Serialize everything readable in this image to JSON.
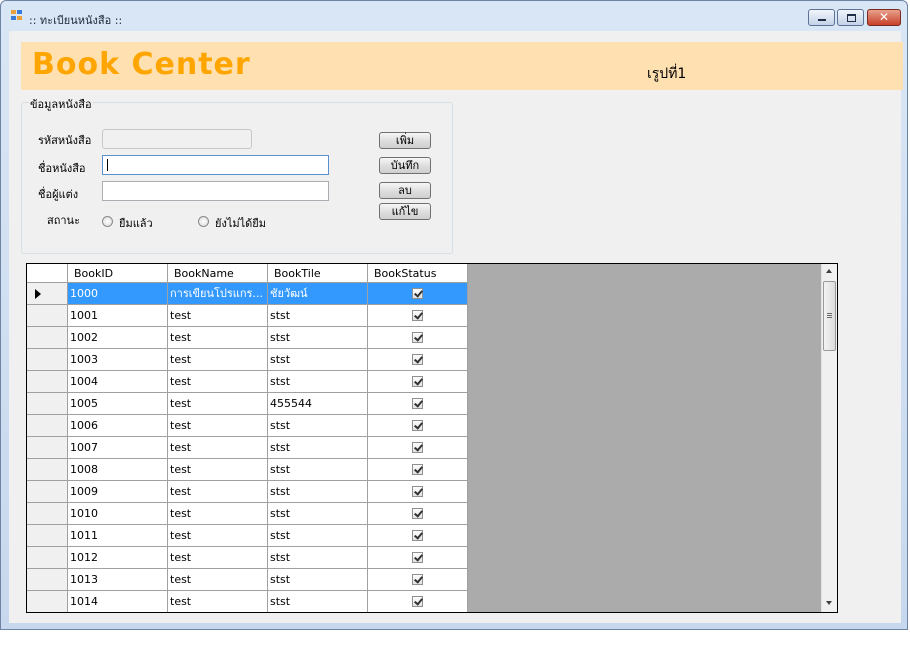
{
  "window": {
    "title": ":: ทะเบียนหนังสือ ::"
  },
  "banner": {
    "brand": "Book Center",
    "form_label": "เรูปที่1"
  },
  "group": {
    "title": "ข้อมูลหนังสือ",
    "fields": {
      "book_id_label": "รหัสหนังสือ",
      "book_id_value": "",
      "book_name_label": "ชื่อหนังสือ",
      "book_name_value": "",
      "author_label": "ชื่อผู้แต่ง",
      "author_value": "",
      "status_label": "สถานะ",
      "status_options": [
        "ยืมแล้ว",
        "ยังไม่ได้ยืม"
      ]
    },
    "buttons": {
      "add": "เพิ่ม",
      "save": "บันทึก",
      "delete": "ลบ",
      "edit": "แก้ไข"
    }
  },
  "grid": {
    "columns": [
      "BookID",
      "BookName",
      "BookTile",
      "BookStatus"
    ],
    "rows": [
      {
        "id": "1000",
        "name": "การเขียนโปรแกร...",
        "tile": "ชัยวัฒน์",
        "status": true
      },
      {
        "id": "1001",
        "name": "test",
        "tile": "stst",
        "status": true
      },
      {
        "id": "1002",
        "name": "test",
        "tile": "stst",
        "status": true
      },
      {
        "id": "1003",
        "name": "test",
        "tile": "stst",
        "status": true
      },
      {
        "id": "1004",
        "name": "test",
        "tile": "stst",
        "status": true
      },
      {
        "id": "1005",
        "name": "test",
        "tile": "455544",
        "status": true
      },
      {
        "id": "1006",
        "name": "test",
        "tile": "stst",
        "status": true
      },
      {
        "id": "1007",
        "name": "test",
        "tile": "stst",
        "status": true
      },
      {
        "id": "1008",
        "name": "test",
        "tile": "stst",
        "status": true
      },
      {
        "id": "1009",
        "name": "test",
        "tile": "stst",
        "status": true
      },
      {
        "id": "1010",
        "name": "test",
        "tile": "stst",
        "status": true
      },
      {
        "id": "1011",
        "name": "test",
        "tile": "stst",
        "status": true
      },
      {
        "id": "1012",
        "name": "test",
        "tile": "stst",
        "status": true
      },
      {
        "id": "1013",
        "name": "test",
        "tile": "stst",
        "status": true
      },
      {
        "id": "1014",
        "name": "test",
        "tile": "stst",
        "status": true
      }
    ]
  }
}
